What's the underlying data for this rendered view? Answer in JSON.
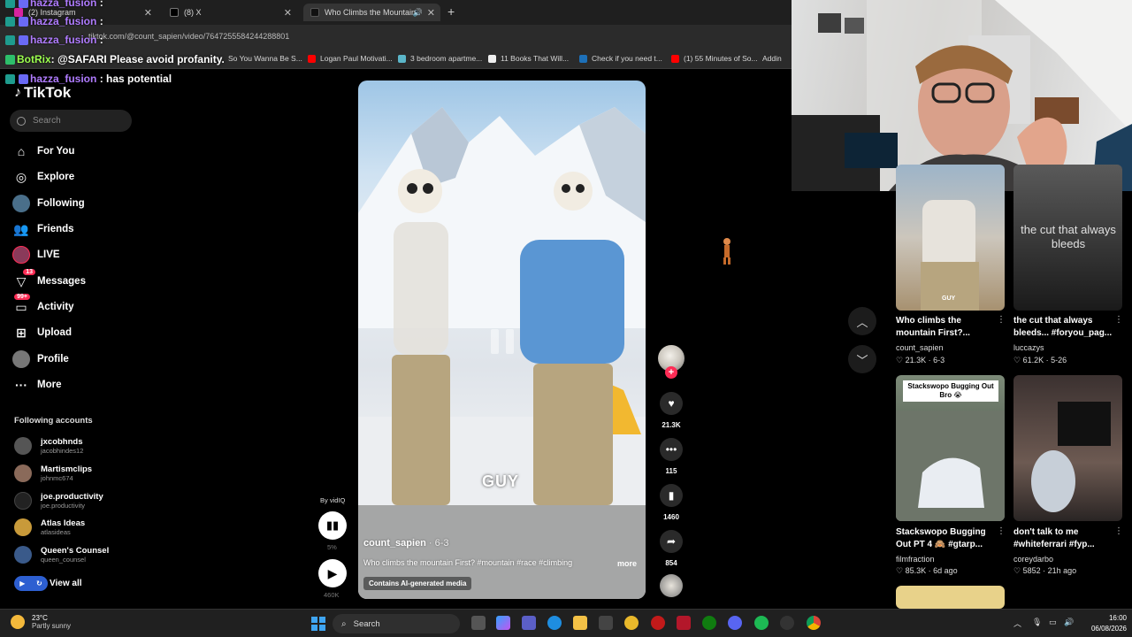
{
  "browser": {
    "tabs": [
      {
        "label": "(2) Instagram",
        "favicon_color": "#d6249f"
      },
      {
        "label": "(8) X",
        "favicon_color": "#000000"
      },
      {
        "label": "Who Climbs the Mountain",
        "favicon_color": "#111111"
      }
    ],
    "url": "tiktok.com/@count_sapien/video/7647255584244288801",
    "bookmarks": [
      {
        "label": "So You Wanna Be S...",
        "color": "#2c2c2c"
      },
      {
        "label": "Logan Paul Motivati...",
        "color": "#ff0000"
      },
      {
        "label": "3 bedroom apartme...",
        "color": "#5bb6c9"
      },
      {
        "label": "11 Books That Will...",
        "color": "#111111"
      },
      {
        "label": "Check if you need t...",
        "color": "#1d70b8"
      },
      {
        "label": "(1) 55 Minutes of So...",
        "color": "#ff0000"
      },
      {
        "label": "Addin",
        "color": "#888888"
      }
    ]
  },
  "chat": [
    {
      "user": "hazza_fusion",
      "msg": ":"
    },
    {
      "user": "hazza_fusion",
      "msg": ":"
    },
    {
      "user": "hazza_fusion",
      "msg": ":"
    },
    {
      "user": "BotRix",
      "msg": ": @SAFARI Please avoid profanity."
    },
    {
      "user": "hazza_fusion",
      "msg": ": has potential"
    }
  ],
  "tiktok": {
    "logo": "TikTok",
    "search_placeholder": "Search",
    "nav": [
      {
        "label": "For You",
        "icon": "home-icon"
      },
      {
        "label": "Explore",
        "icon": "compass-icon"
      },
      {
        "label": "Following",
        "icon": "following-icon"
      },
      {
        "label": "Friends",
        "icon": "friends-icon"
      },
      {
        "label": "LIVE",
        "icon": "live-icon"
      },
      {
        "label": "Messages",
        "icon": "messages-icon",
        "badge": "13"
      },
      {
        "label": "Activity",
        "icon": "activity-icon",
        "badge": "99+"
      },
      {
        "label": "Upload",
        "icon": "upload-icon"
      },
      {
        "label": "Profile",
        "icon": "profile-icon"
      },
      {
        "label": "More",
        "icon": "more-icon"
      }
    ],
    "following_title": "Following accounts",
    "accounts": [
      {
        "name": "jxcobhnds",
        "handle": "jacobhindes12",
        "color": "#555"
      },
      {
        "name": "Martismclips",
        "handle": "johnmc674",
        "color": "#8a6a5a"
      },
      {
        "name": "joe.productivity",
        "handle": "joe.productivity",
        "color": "#222"
      },
      {
        "name": "Atlas Ideas",
        "handle": "atlasideas",
        "color": "#c89a3a"
      },
      {
        "name": "Queen's Counsel",
        "handle": "queen_counsel",
        "color": "#3a5a8a"
      }
    ],
    "view_all": "View all"
  },
  "video": {
    "overlay_text": "GUY",
    "author": "count_sapien",
    "date": "· 6-3",
    "description": "Who climbs the mountain First? #mountain #race #climbing",
    "more": "more",
    "ai_label": "Contains AI-generated media",
    "vidiq": "By vidIQ",
    "vidiq_pct": "5%",
    "views": "460K",
    "likes": "21.3K",
    "comments": "115",
    "saves": "1460",
    "shares": "854"
  },
  "recommendations": [
    {
      "title": "Who climbs the mountain First?...",
      "author": "count_sapien",
      "likes": "21.3K",
      "age": "6-3",
      "thumb_text": "GUY"
    },
    {
      "title": "the cut that always bleeds... #foryou_pag...",
      "author": "luccazys",
      "likes": "61.2K",
      "age": "5-26",
      "thumb_text": "the cut that always bleeds"
    },
    {
      "title": "Stackswopo Bugging Out PT 4 🙈 #gtarp...",
      "author": "filmfraction",
      "likes": "85.3K",
      "age": "6d ago",
      "thumb_text": "Stackswopo Bugging Out Bro 😭"
    },
    {
      "title": "don't talk to me #whiteferrari #fyp...",
      "author": "coreydarbo",
      "likes": "5852",
      "age": "21h ago",
      "thumb_text": ""
    }
  ],
  "taskbar": {
    "temp": "23°C",
    "weather": "Partly sunny",
    "search": "Search",
    "time": "16:00",
    "date": "06/08/2026"
  },
  "colors": {
    "accent": "#fe2c55",
    "chat_user": "#b07cff",
    "background": "#000000"
  }
}
